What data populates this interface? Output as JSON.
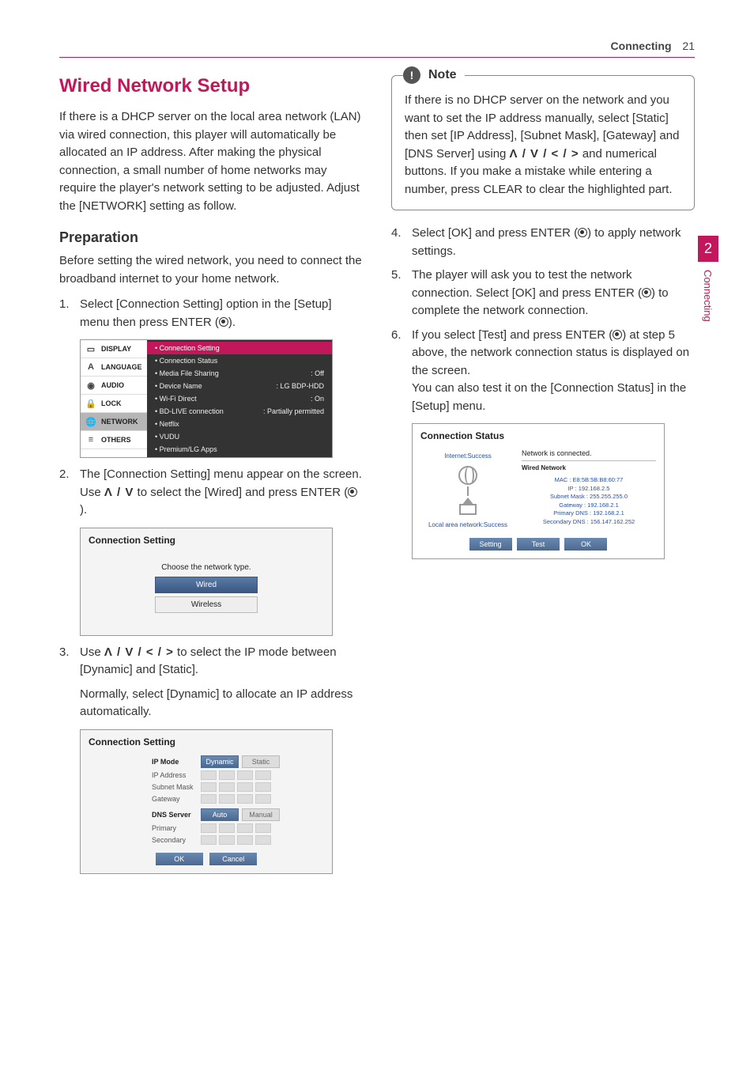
{
  "header": {
    "section": "Connecting",
    "page": "21"
  },
  "sidetab": {
    "number": "2",
    "label": "Connecting"
  },
  "left": {
    "title": "Wired Network Setup",
    "intro": "If there is a DHCP server on the local area network (LAN) via wired connection, this player will automatically be allocated an IP address. After making the physical connection, a small number of home networks may require the player's network setting to be adjusted. Adjust the [NETWORK] setting as follow.",
    "prep_title": "Preparation",
    "prep_text": "Before setting the wired network, you need to connect the broadband internet to your home network.",
    "step1": "Select [Connection Setting] option in the [Setup] menu then press ENTER (",
    "step1b": ").",
    "step2a": "The [Connection Setting] menu appear on the screen. Use ",
    "step2_arrows": "Λ / V",
    "step2b": " to select the [Wired] and press ENTER (",
    "step2c": ").",
    "step3a": "Use ",
    "step3_arrows": "Λ / V / < / >",
    "step3b": " to select the IP mode between [Dynamic] and [Static].",
    "step3_note": "Normally, select [Dynamic] to allocate an IP address automatically."
  },
  "setup_menu": {
    "side": [
      {
        "icon": "▭",
        "label": "DISPLAY"
      },
      {
        "icon": "A",
        "label": "LANGUAGE"
      },
      {
        "icon": "◉",
        "label": "AUDIO"
      },
      {
        "icon": "🔒",
        "label": "LOCK"
      },
      {
        "icon": "🌐",
        "label": "NETWORK"
      },
      {
        "icon": "≡",
        "label": "OTHERS"
      }
    ],
    "rows": [
      {
        "label": "Connection Setting",
        "val": "",
        "sel": true
      },
      {
        "label": "Connection Status",
        "val": ""
      },
      {
        "label": "Media File Sharing",
        "val": ": Off"
      },
      {
        "label": "Device Name",
        "val": ": LG BDP-HDD"
      },
      {
        "label": "Wi-Fi Direct",
        "val": ": On"
      },
      {
        "label": "BD-LIVE connection",
        "val": ": Partially permitted"
      },
      {
        "label": "Netflix",
        "val": ""
      },
      {
        "label": "VUDU",
        "val": ""
      },
      {
        "label": "Premium/LG Apps",
        "val": ""
      }
    ]
  },
  "conn_type": {
    "title": "Connection Setting",
    "sub": "Choose the network type.",
    "opt1": "Wired",
    "opt2": "Wireless"
  },
  "ip_mode": {
    "title": "Connection Setting",
    "ip_label": "IP Mode",
    "dynamic": "Dynamic",
    "static": "Static",
    "ip_addr": "IP Address",
    "subnet": "Subnet Mask",
    "gateway": "Gateway",
    "dns_label": "DNS Server",
    "auto": "Auto",
    "manual": "Manual",
    "primary": "Primary",
    "secondary": "Secondary",
    "ok": "OK",
    "cancel": "Cancel"
  },
  "right": {
    "note_label": "Note",
    "note_a": "If there is no DHCP server on the network and you want to set the IP address manually, select [Static] then set [IP Address], [Subnet Mask], [Gateway] and [DNS Server] using ",
    "note_arrows": "Λ / V / < / >",
    "note_b": " and numerical buttons. If you make a mistake while entering a number, press CLEAR to clear the highlighted part.",
    "step4a": "Select [OK] and press ENTER (",
    "step4b": ") to apply network settings.",
    "step5a": "The player will ask you to test the network connection. Select [OK] and press ENTER (",
    "step5b": ") to complete the network connection.",
    "step6a": "If you select [Test] and press ENTER (",
    "step6b": ") at step 5 above, the network connection status is displayed on the screen.",
    "step6c": "You can also test it on the [Connection Status] in the [Setup] menu."
  },
  "status": {
    "title": "Connection Status",
    "inet": "Internet:Success",
    "lan": "Local area network:Success",
    "msg": "Network is connected.",
    "net": "Wired Network",
    "mac": "MAC : E8:5B:5B:B8:60:77",
    "ip": "IP : 192.168.2.5",
    "subnet": "Subnet Mask : 255.255.255.0",
    "gateway": "Gateway : 192.168.2.1",
    "pdns": "Primary DNS : 192.168.2.1",
    "sdns": "Secondary DNS : 156.147.162.252",
    "setting": "Setting",
    "test": "Test",
    "ok": "OK"
  }
}
